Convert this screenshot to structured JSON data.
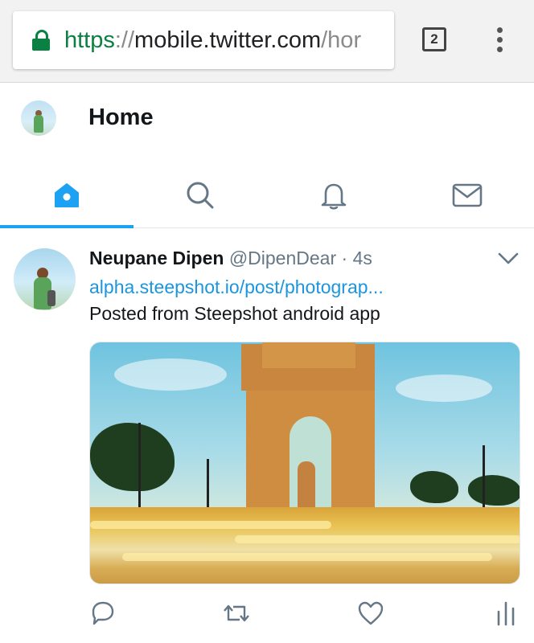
{
  "browser": {
    "url_scheme": "https",
    "url_separator": "://",
    "url_host": "mobile.twitter.com",
    "url_path": "/hor",
    "tab_count": "2"
  },
  "header": {
    "title": "Home"
  },
  "nav": {
    "items": [
      {
        "name": "home",
        "icon": "home-icon",
        "active": true
      },
      {
        "name": "search",
        "icon": "search-icon"
      },
      {
        "name": "notifications",
        "icon": "bell-icon"
      },
      {
        "name": "messages",
        "icon": "mail-icon"
      }
    ],
    "accent_color": "#1da1f2"
  },
  "tweet": {
    "name": "Neupane Dipen",
    "handle": "@DipenDear",
    "separator": "·",
    "time": "4s",
    "link": "alpha.steepshot.io/post/photograp...",
    "text": "Posted from Steepshot android app",
    "media": "India Gate photograph",
    "actions": [
      "reply-icon",
      "retweet-icon",
      "like-icon",
      "analytics-icon"
    ]
  },
  "colors": {
    "link": "#1b95e0",
    "secure": "#0b8043",
    "muted": "#657786"
  }
}
